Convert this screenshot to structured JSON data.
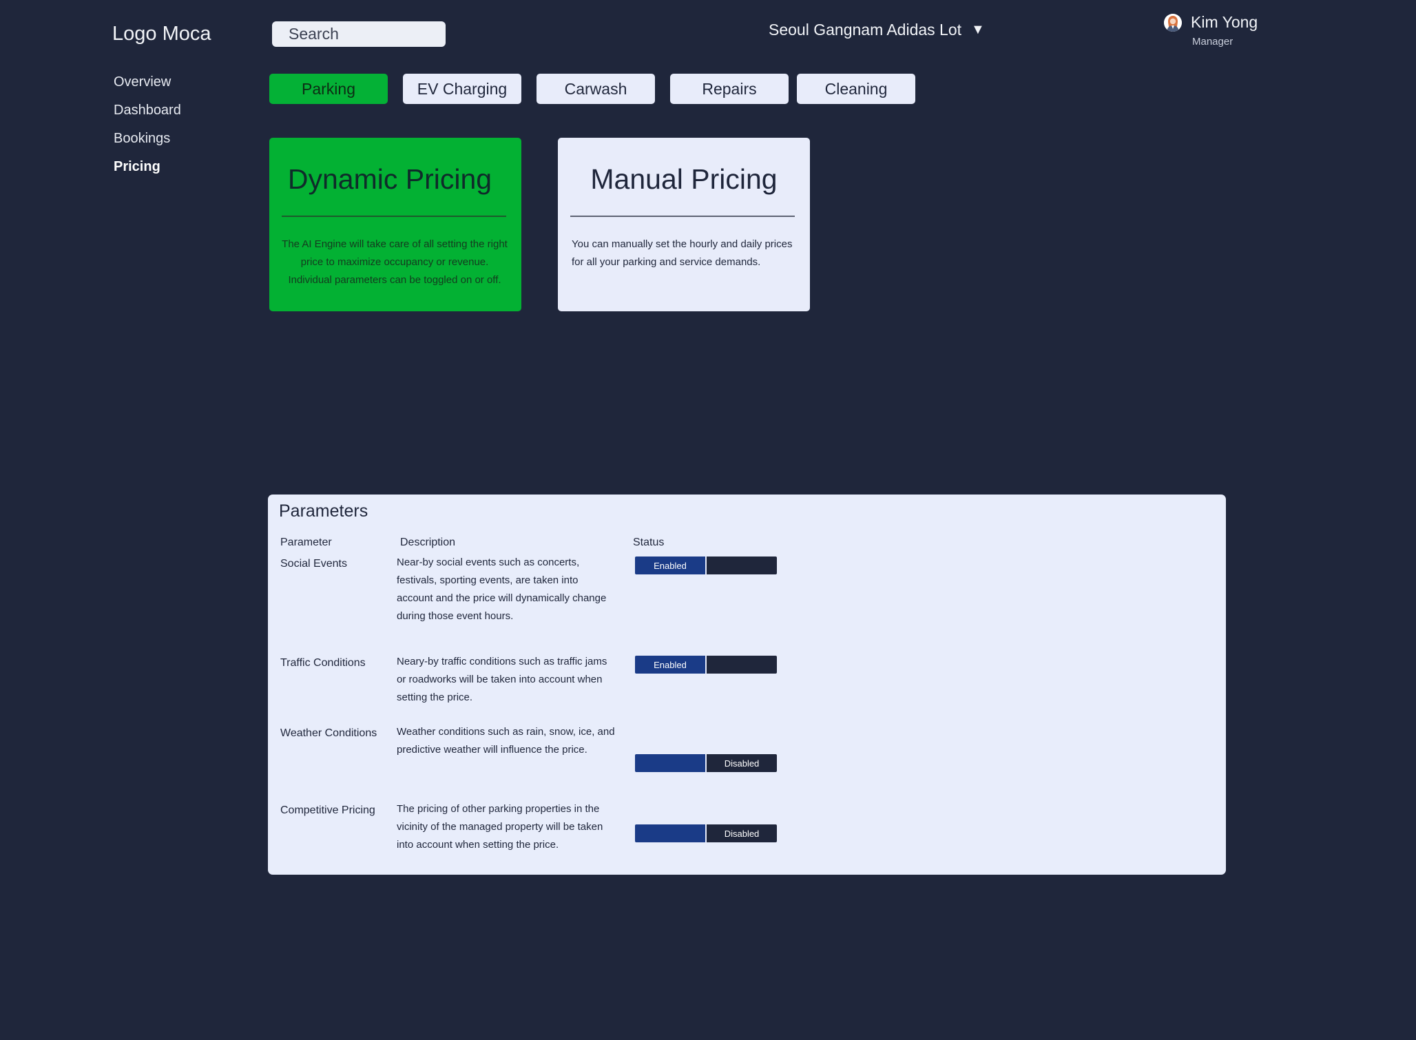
{
  "brand": {
    "logo_text": "Logo Moca"
  },
  "search": {
    "placeholder": "Search"
  },
  "location": {
    "selected": "Seoul Gangnam Adidas Lot",
    "caret": "▼"
  },
  "user": {
    "name": "Kim Yong",
    "role": "Manager",
    "avatar_icon": "user-avatar-icon"
  },
  "sidebar": {
    "items": [
      {
        "label": "Overview",
        "active": false
      },
      {
        "label": "Dashboard",
        "active": false
      },
      {
        "label": "Bookings",
        "active": false
      },
      {
        "label": "Pricing",
        "active": true
      }
    ]
  },
  "tabs": [
    {
      "label": "Parking",
      "active": true
    },
    {
      "label": "EV Charging",
      "active": false
    },
    {
      "label": "Carwash",
      "active": false
    },
    {
      "label": "Repairs",
      "active": false
    },
    {
      "label": "Cleaning",
      "active": false
    }
  ],
  "pricing_modes": {
    "dynamic": {
      "title": "Dynamic Pricing",
      "description": "The AI Engine will take care of all setting the right price to maximize occupancy or revenue. Individual parameters can be toggled on or off.",
      "selected": true
    },
    "manual": {
      "title": "Manual Pricing",
      "description": "You can manually set the hourly and daily prices for all your parking and service demands.",
      "selected": false
    }
  },
  "parameters": {
    "title": "Parameters",
    "headers": {
      "parameter": "Parameter",
      "description": "Description",
      "status": "Status"
    },
    "rows": [
      {
        "name": "Social Events",
        "description": "Near-by social events such as concerts, festivals, sporting events, are taken into account and the price will dynamically change during those event hours.",
        "status": "Enabled",
        "left_label": "Enabled",
        "right_label": ""
      },
      {
        "name": "Traffic Conditions",
        "description": "Neary-by traffic conditions such as traffic jams or roadworks will be taken into account when setting the price.",
        "status": "Enabled",
        "left_label": "Enabled",
        "right_label": ""
      },
      {
        "name": "Weather Conditions",
        "description": "Weather conditions such as rain, snow, ice, and predictive weather will influence the price.",
        "status": "Disabled",
        "left_label": "",
        "right_label": "Disabled"
      },
      {
        "name": "Competitive Pricing",
        "description": "The pricing of other parking properties in the vicinity of the managed property will be taken into account when setting the price.",
        "status": "Disabled",
        "left_label": "",
        "right_label": "Disabled"
      }
    ]
  },
  "colors": {
    "background": "#1f263b",
    "accent_green": "#04b136",
    "panel": "#e8edfb",
    "toggle_blue": "#1a3b87",
    "toggle_dark": "#1f263b"
  }
}
